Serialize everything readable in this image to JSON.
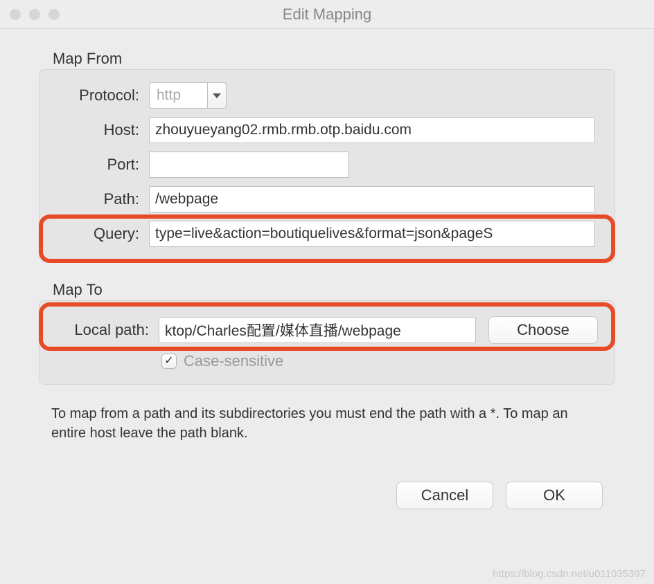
{
  "window": {
    "title": "Edit Mapping"
  },
  "map_from": {
    "section_label": "Map From",
    "protocol_label": "Protocol:",
    "protocol_value": "http",
    "host_label": "Host:",
    "host_value": "zhouyueyang02.rmb.rmb.otp.baidu.com",
    "port_label": "Port:",
    "port_value": "",
    "path_label": "Path:",
    "path_value": "/webpage",
    "query_label": "Query:",
    "query_value": "type=live&action=boutiquelives&format=json&pageS"
  },
  "map_to": {
    "section_label": "Map To",
    "local_path_label": "Local path:",
    "local_path_value": "ktop/Charles配置/媒体直播/webpage",
    "choose_label": "Choose",
    "case_sensitive_label": "Case-sensitive",
    "case_sensitive_checked": true
  },
  "hint": "To map from a path and its subdirectories you must end the path with a *. To map an entire host leave the path blank.",
  "buttons": {
    "cancel": "Cancel",
    "ok": "OK"
  },
  "watermark": "https://blog.csdn.net/u011035397"
}
